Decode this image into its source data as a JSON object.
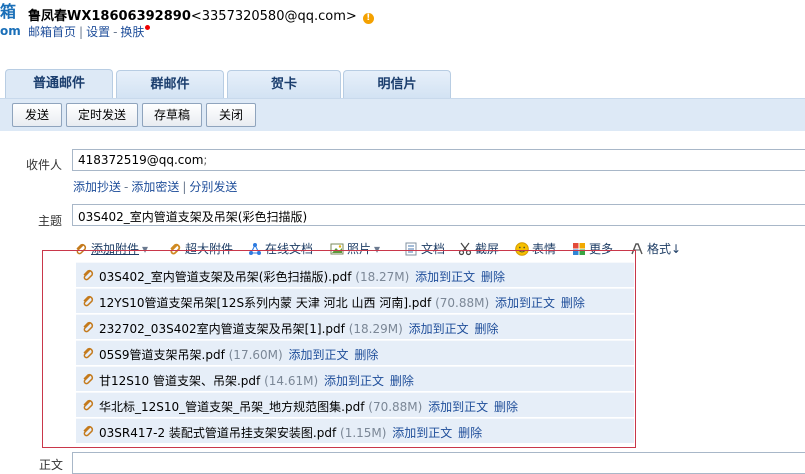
{
  "header": {
    "logo_fragment_top": "箱",
    "logo_fragment_bottom": "om",
    "sender_name": "鲁凤春WX18606392890",
    "sender_email": "<3357320580@qq.com>",
    "warn_icon": "exclamation-icon",
    "links": [
      "邮箱首页",
      "设置",
      "换肤"
    ]
  },
  "tabs": [
    {
      "label": "普通邮件",
      "active": true
    },
    {
      "label": "群邮件"
    },
    {
      "label": "贺卡"
    },
    {
      "label": "明信片"
    }
  ],
  "toolbar_buttons": [
    "发送",
    "定时发送",
    "存草稿",
    "关闭"
  ],
  "form": {
    "to_label": "收件人",
    "to_value": "418372519@qq.com",
    "to_separator": ";",
    "cc_links": [
      "添加抄送",
      "添加密送",
      "分别发送"
    ],
    "subject_label": "主题",
    "subject_value": "03S402_室内管道支架及吊架(彩色扫描版)",
    "body_label": "正文"
  },
  "attach_toolbar": [
    {
      "label": "添加附件",
      "icon": "paperclip-icon",
      "dropdown": true
    },
    {
      "label": "超大附件",
      "icon": "paperclip-large-icon"
    },
    {
      "label": "在线文档",
      "icon": "share-icon"
    },
    {
      "label": "照片",
      "icon": "photo-icon",
      "dropdown": true
    },
    {
      "label": "文档",
      "icon": "document-icon"
    },
    {
      "label": "截屏",
      "icon": "scissors-icon"
    },
    {
      "label": "表情",
      "icon": "smiley-icon"
    },
    {
      "label": "更多",
      "icon": "grid-icon"
    },
    {
      "label": "格式",
      "icon": "format-icon"
    }
  ],
  "attach_toolbar_dropdown_marker": "▾",
  "attach_toolbar_format_suffix": "↓",
  "attachments": [
    {
      "name": "03S402_室内管道支架及吊架(彩色扫描版).pdf",
      "size": "(18.27M)"
    },
    {
      "name": "12YS10管道支架吊架[12S系列内蒙 天津 河北 山西 河南].pdf",
      "size": "(70.88M)"
    },
    {
      "name": "232702_03S402室内管道支架及吊架[1].pdf",
      "size": "(18.29M)"
    },
    {
      "name": "05S9管道支架吊架.pdf",
      "size": "(17.60M)"
    },
    {
      "name": "甘12S10 管道支架、吊架.pdf",
      "size": "(14.61M)"
    },
    {
      "name": "华北标_12S10_管道支架_吊架_地方规范图集.pdf",
      "size": "(70.88M)"
    },
    {
      "name": "03SR417-2 装配式管道吊挂支架安装图.pdf",
      "size": "(1.15M)"
    }
  ],
  "attachment_actions": {
    "add_to_body": "添加到正文",
    "delete": "删除"
  },
  "colors": {
    "link": "#1f4e9a",
    "tab_bg": "#dde9f6",
    "highlight_border": "#c9374a",
    "row_bg": "#e6eef8"
  }
}
